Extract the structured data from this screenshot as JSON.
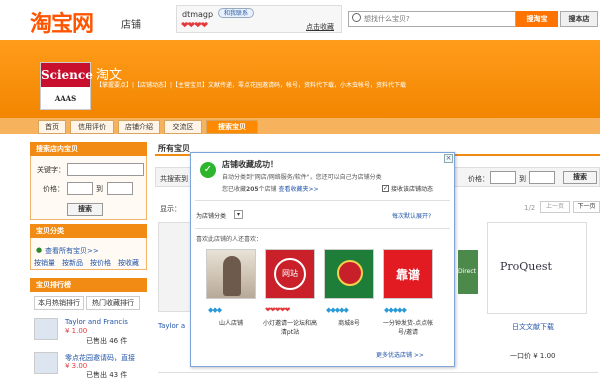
{
  "header": {
    "logo": "淘宝网",
    "logo_sub": "店铺",
    "seller_name": "dtmagp",
    "wangwang_label": "和我联系",
    "hearts": "❤❤❤❤",
    "fav_link": "点击收藏",
    "search_placeholder": "想找什么宝贝?",
    "btn_search_taobao": "搜淘宝",
    "btn_search_store": "搜本店"
  },
  "banner": {
    "logo_science": "Science",
    "logo_aaas": "AAAS",
    "shop_title": "淘文",
    "shop_links": "【掌握要点】|【店铺动态】|【主营宝贝】文献传递，零点花园邀请码，帐号，资料代下载，小木虫帐号，资料代下载"
  },
  "nav": {
    "tabs": [
      "首页",
      "信用评价",
      "店铺介绍",
      "交流区",
      "搜索宝贝"
    ]
  },
  "sidebar": {
    "search_head": "搜索店内宝贝",
    "keyword_label": "关键字：",
    "price_label": "价格：",
    "to_label": "到",
    "search_btn": "搜索",
    "category_head": "宝贝分类",
    "view_all": "查看所有宝贝>>",
    "sort_links": [
      "按销量",
      "按新品",
      "按价格",
      "按收藏"
    ],
    "rank_head": "宝贝排行榜",
    "rank_tabs": [
      "本月热销排行",
      "热门收藏排行"
    ],
    "rank_items": [
      {
        "title": "Taylor and Francis",
        "price": "¥ 1.00",
        "sold": "已售出 46 件"
      },
      {
        "title": "零点花园邀请码，直接",
        "price": "¥ 3.00",
        "sold": "已售出 43 件"
      }
    ]
  },
  "main": {
    "title": "所有宝贝",
    "filter_prefix": "共搜索到",
    "price_label": "价格：",
    "to_label": "到",
    "search_btn": "搜索",
    "sort_prefix": "显示：",
    "page_info": "1/2",
    "prev_page": "上一页",
    "next_page": "下一页",
    "cards": [
      {
        "title": "Taylor a"
      },
      {
        "title": "日文文献下载",
        "price": "一口价 ¥ 1.00",
        "brand": "ProQuest"
      }
    ],
    "direct_tag": "Direct"
  },
  "popup": {
    "title": "店铺收藏成功！",
    "sub1": "自动分类到\"网店/网络服务/软件\"，您还可以自己为店铺分类",
    "sub2_a": "您已收藏",
    "sub2_count": "205",
    "sub2_b": "个店铺",
    "sub2_link": "查看收藏夹>>",
    "checkbox_label": "接收该店铺动态",
    "category_select": "为店铺分类",
    "expand_link": "每次默认展开?",
    "also_like": "喜欢此店铺的人还喜欢：",
    "recommendations": [
      {
        "name": "山人店铺",
        "level": "❤❤❤❤"
      },
      {
        "name": "小灯邀请一论坛和高清pt站",
        "level": "❤❤❤❤❤"
      },
      {
        "name": "商城8号",
        "level": "◆◆◆◆◆"
      },
      {
        "name": "一分钟发货-点点帐号/邀请",
        "level": "◆◆◆◆◆"
      }
    ],
    "rec_labels": [
      "网站",
      "靠谱"
    ],
    "more_shops": "更多优选店铺 >>"
  },
  "colors": {
    "accent": "#ff5500",
    "banner": "#f28500",
    "popup_border": "#7ea4d9"
  }
}
